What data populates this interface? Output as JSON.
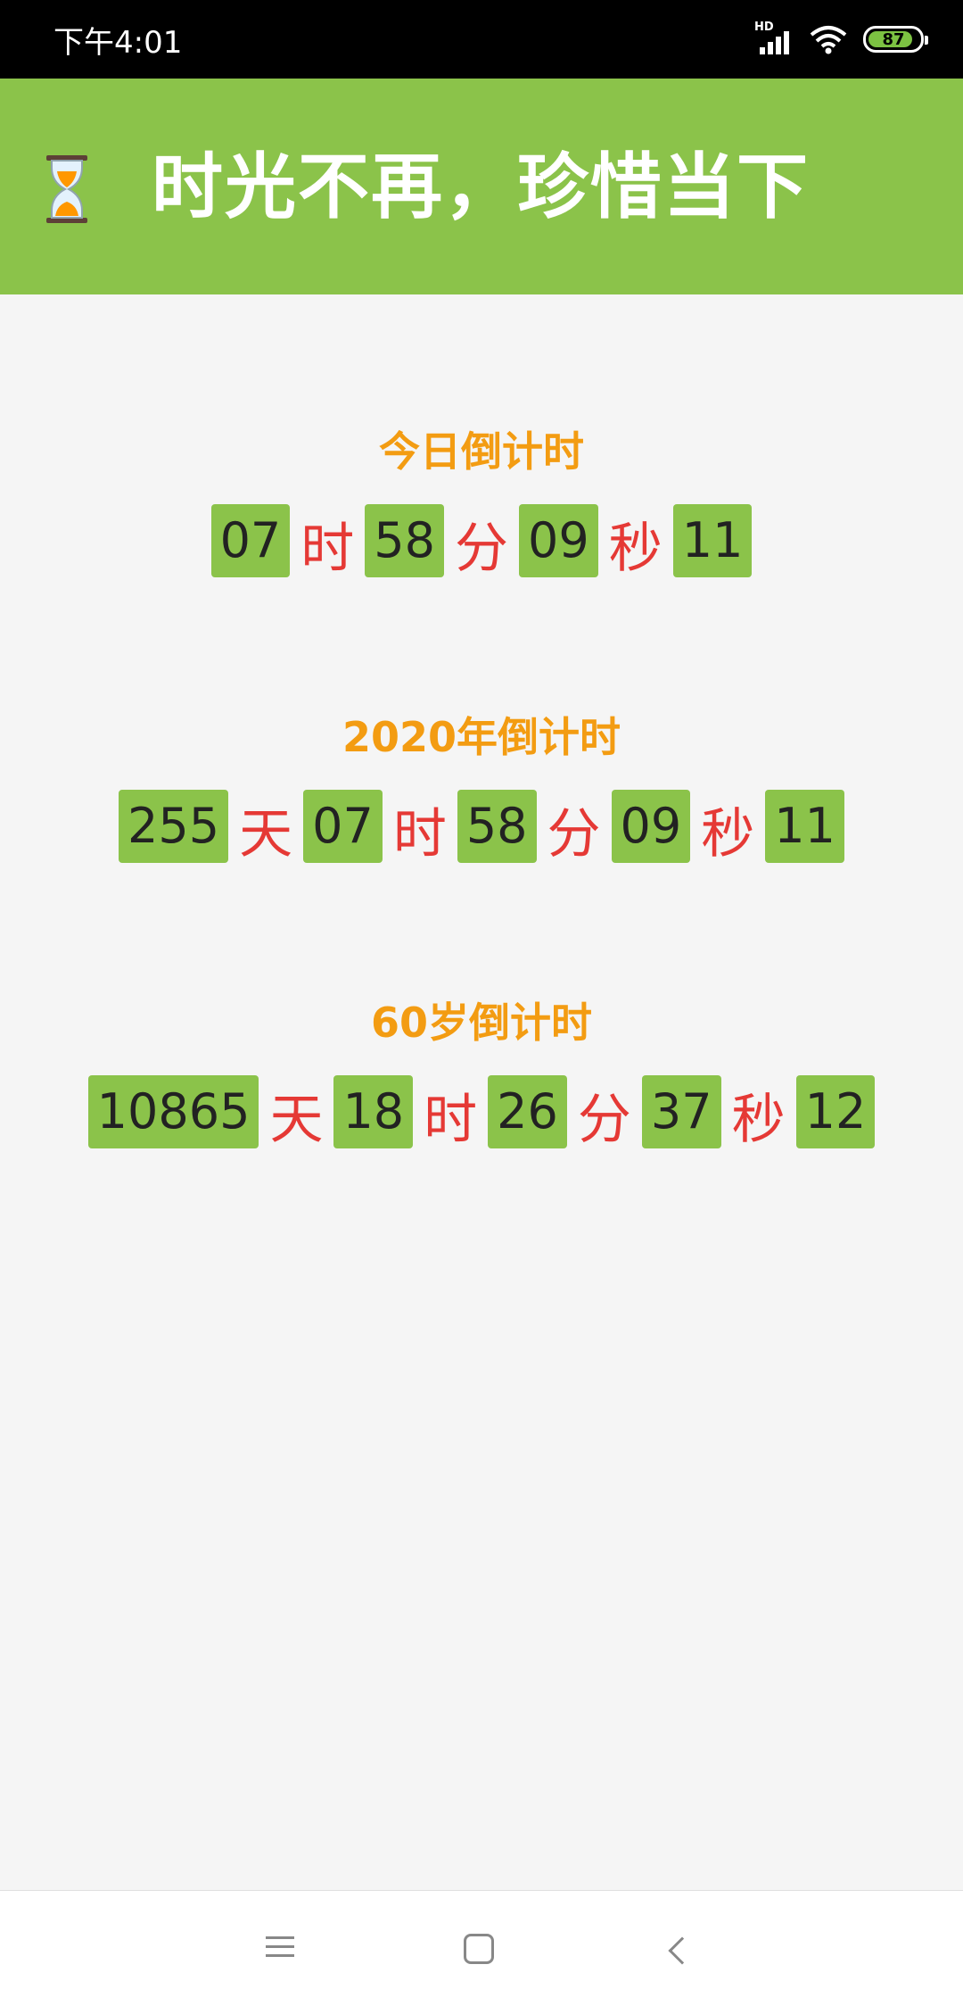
{
  "status_bar": {
    "time": "下午4:01",
    "hd": "HD",
    "battery": "87",
    "battery_fill": 0.87,
    "icons": [
      "signal-icon",
      "wifi-icon",
      "battery-icon"
    ]
  },
  "app_bar": {
    "icon": "hourglass-icon",
    "title": "时光不再，珍惜当下",
    "color": "#8bc34a"
  },
  "sections": [
    {
      "title": "今日倒计时",
      "parts": [
        {
          "value": "07",
          "unit": "时"
        },
        {
          "value": "58",
          "unit": "分"
        },
        {
          "value": "09",
          "unit": "秒"
        },
        {
          "value": "11",
          "unit": ""
        }
      ]
    },
    {
      "title": "2020年倒计时",
      "parts": [
        {
          "value": "255",
          "unit": "天"
        },
        {
          "value": "07",
          "unit": "时"
        },
        {
          "value": "58",
          "unit": "分"
        },
        {
          "value": "09",
          "unit": "秒"
        },
        {
          "value": "11",
          "unit": ""
        }
      ]
    },
    {
      "title": "60岁倒计时",
      "parts": [
        {
          "value": "10865",
          "unit": "天"
        },
        {
          "value": "18",
          "unit": "时"
        },
        {
          "value": "26",
          "unit": "分"
        },
        {
          "value": "37",
          "unit": "秒"
        },
        {
          "value": "12",
          "unit": ""
        }
      ]
    }
  ],
  "colors": {
    "title": "#f39c12",
    "unit": "#e53935",
    "box": "#8bc34a"
  },
  "nav_bar": {
    "icons": [
      "menu-icon",
      "home-icon",
      "back-icon"
    ]
  }
}
